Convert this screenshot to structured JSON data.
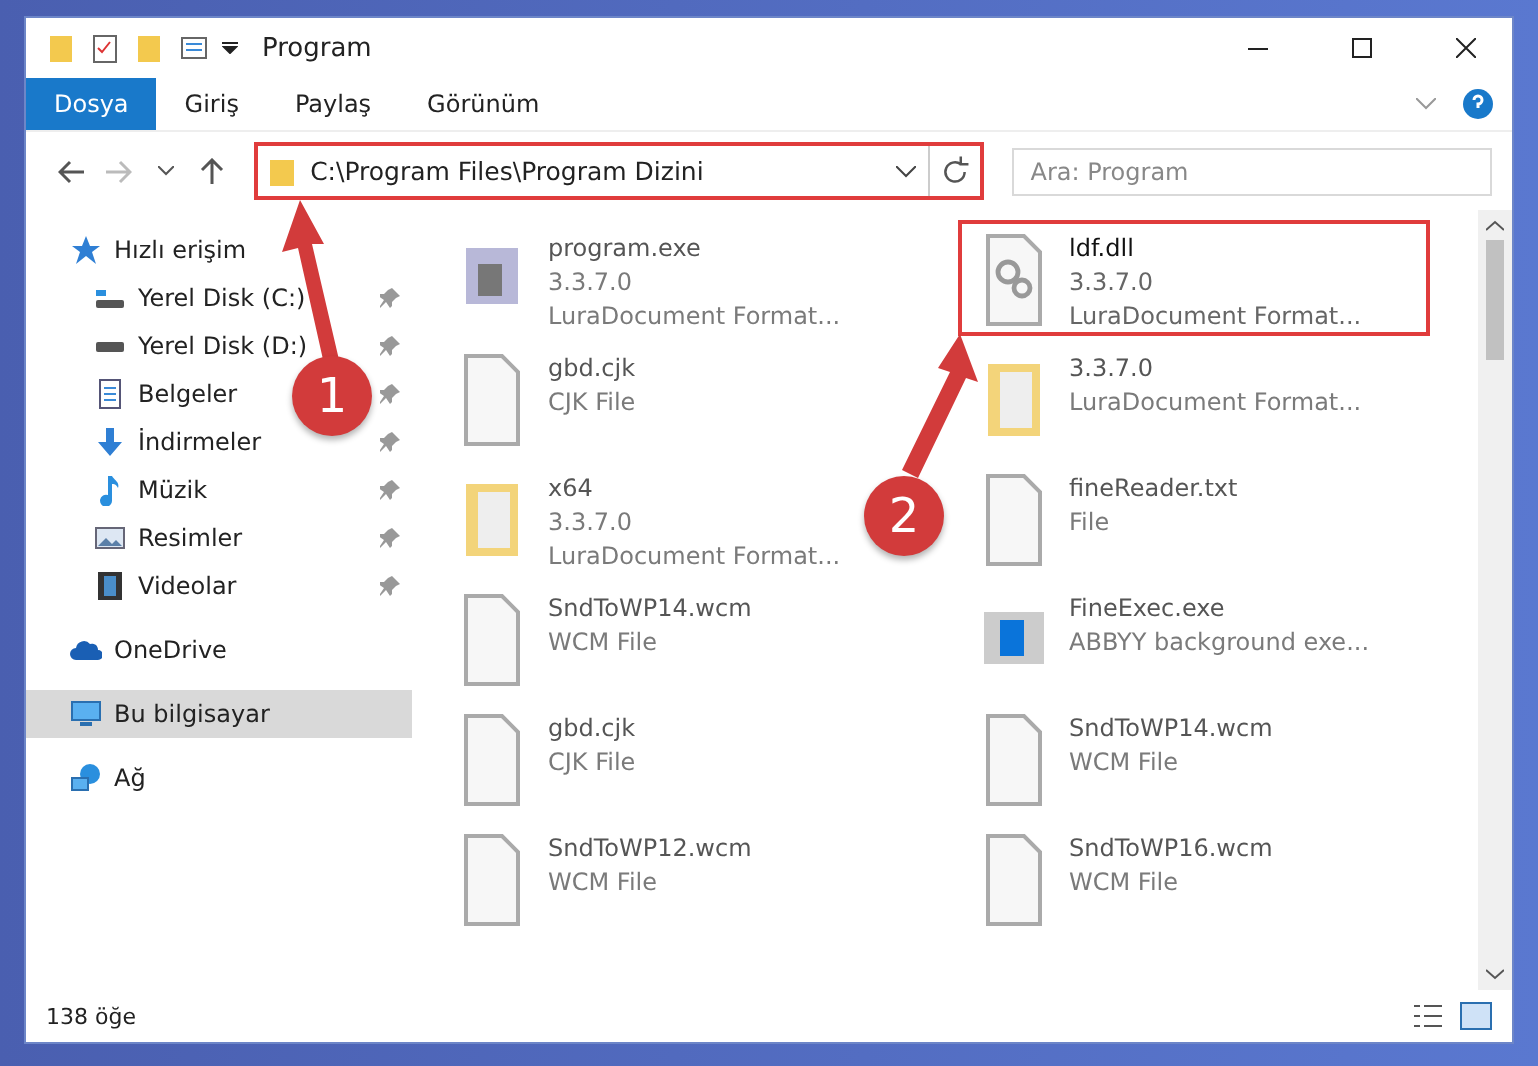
{
  "window": {
    "title": "Program"
  },
  "ribbon_tabs": [
    {
      "label": "Dosya",
      "selected": true
    },
    {
      "label": "Giriş",
      "selected": false
    },
    {
      "label": "Paylaş",
      "selected": false
    },
    {
      "label": "Görünüm",
      "selected": false
    }
  ],
  "address_bar": {
    "path": "C:\\Program Files\\Program Dizini",
    "highlighted": true
  },
  "search": {
    "placeholder": "Ara: Program"
  },
  "sidebar": {
    "items": [
      {
        "kind": "quick",
        "label": "Hızlı erişim",
        "selected": false,
        "children": [
          {
            "kind": "drive-c",
            "label": "Yerel Disk (C:)",
            "pinned": true,
            "selected": false
          },
          {
            "kind": "drive",
            "label": "Yerel Disk (D:)",
            "pinned": true,
            "selected": false
          },
          {
            "kind": "docs",
            "label": "Belgeler",
            "pinned": true,
            "selected": false
          },
          {
            "kind": "download",
            "label": "İndirmeler",
            "pinned": true,
            "selected": false
          },
          {
            "kind": "music",
            "label": "Müzik",
            "pinned": true,
            "selected": false
          },
          {
            "kind": "pictures",
            "label": "Resimler",
            "pinned": true,
            "selected": false
          },
          {
            "kind": "videos",
            "label": "Videolar",
            "pinned": true,
            "selected": false
          }
        ]
      },
      {
        "kind": "cloud",
        "label": "OneDrive",
        "selected": false
      },
      {
        "kind": "pc",
        "label": "Bu bilgisayar",
        "selected": true
      },
      {
        "kind": "network",
        "label": "Ağ",
        "selected": false
      }
    ]
  },
  "files": [
    {
      "kind": "exe",
      "lines": [
        "program.exe",
        "3.3.7.0",
        "LuraDocument Format..."
      ],
      "highlighted": false
    },
    {
      "kind": "dll",
      "lines": [
        "ldf.dll",
        "3.3.7.0",
        "LuraDocument Format..."
      ],
      "highlighted": true
    },
    {
      "kind": "file",
      "lines": [
        "gbd.cjk",
        "CJK File"
      ],
      "highlighted": false
    },
    {
      "kind": "folder",
      "lines": [
        "3.3.7.0",
        "LuraDocument Format..."
      ],
      "highlighted": false
    },
    {
      "kind": "folder",
      "lines": [
        "x64",
        "3.3.7.0",
        "LuraDocument Format..."
      ],
      "highlighted": false
    },
    {
      "kind": "text",
      "lines": [
        "fineReader.txt",
        "File"
      ],
      "highlighted": false
    },
    {
      "kind": "file",
      "lines": [
        "SndToWP14.wcm",
        "WCM File"
      ],
      "highlighted": false
    },
    {
      "kind": "app",
      "lines": [
        "FineExec.exe",
        "ABBYY background exe..."
      ],
      "highlighted": false
    },
    {
      "kind": "file",
      "lines": [
        "gbd.cjk",
        "CJK File"
      ],
      "highlighted": false
    },
    {
      "kind": "file",
      "lines": [
        "SndToWP14.wcm",
        "WCM File"
      ],
      "highlighted": false
    },
    {
      "kind": "file",
      "lines": [
        "SndToWP12.wcm",
        "WCM File"
      ],
      "highlighted": false
    },
    {
      "kind": "file",
      "lines": [
        "SndToWP16.wcm",
        "WCM File"
      ],
      "highlighted": false
    }
  ],
  "annotations": [
    {
      "label": "1"
    },
    {
      "label": "2"
    }
  ],
  "status_bar": {
    "count": "138 öğe"
  }
}
